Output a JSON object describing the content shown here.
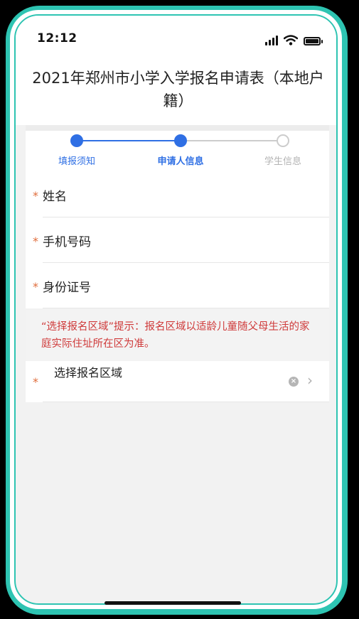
{
  "status_bar": {
    "time": "12:12"
  },
  "header": {
    "title": "2021年郑州市小学入学报名申请表（本地户籍）"
  },
  "steps": [
    {
      "label": "填报须知",
      "state": "done"
    },
    {
      "label": "申请人信息",
      "state": "active"
    },
    {
      "label": "学生信息",
      "state": "pending"
    }
  ],
  "form": {
    "required_mark": "*",
    "name_label": "姓名",
    "phone_label": "手机号码",
    "id_label": "身份证号",
    "notice": "“选择报名区域”提示：报名区域以适龄儿童随父母生活的家庭实际住址所在区为准。",
    "region_label": "选择报名区域"
  },
  "colors": {
    "accent": "#2f6fe4",
    "pending": "#cccccc",
    "warning": "#cf3a3a",
    "required": "#e06d3c",
    "frame": "#2ec4b2"
  },
  "icons": [
    "signal-icon",
    "wifi-icon",
    "battery-icon",
    "clear-icon",
    "chevron-right-icon"
  ]
}
